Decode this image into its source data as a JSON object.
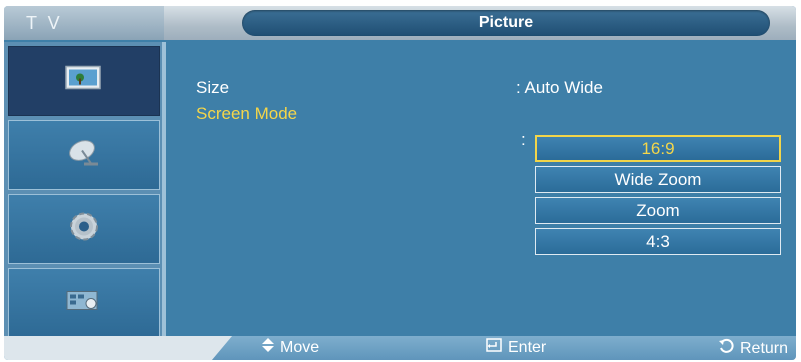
{
  "header": {
    "section_label": "T V",
    "title": "Picture"
  },
  "sidebar": {
    "items": [
      {
        "icon": "picture-icon",
        "active": true
      },
      {
        "icon": "satellite-dish-icon",
        "active": false
      },
      {
        "icon": "setup-gear-icon",
        "active": false
      },
      {
        "icon": "input-source-icon",
        "active": false
      }
    ]
  },
  "menu": {
    "size_label": "Size",
    "size_value": ": Auto Wide",
    "screen_mode_label": "Screen Mode",
    "screen_mode_colon": ":",
    "options": [
      "16:9",
      "Wide Zoom",
      "Zoom",
      "4:3"
    ],
    "selected_option": "16:9"
  },
  "footer": {
    "move_label": "Move",
    "enter_label": "Enter",
    "return_label": "Return"
  },
  "colors": {
    "background": "#3e7fa8",
    "selected_text": "#f4d64a",
    "active_tab": "#223f66"
  }
}
